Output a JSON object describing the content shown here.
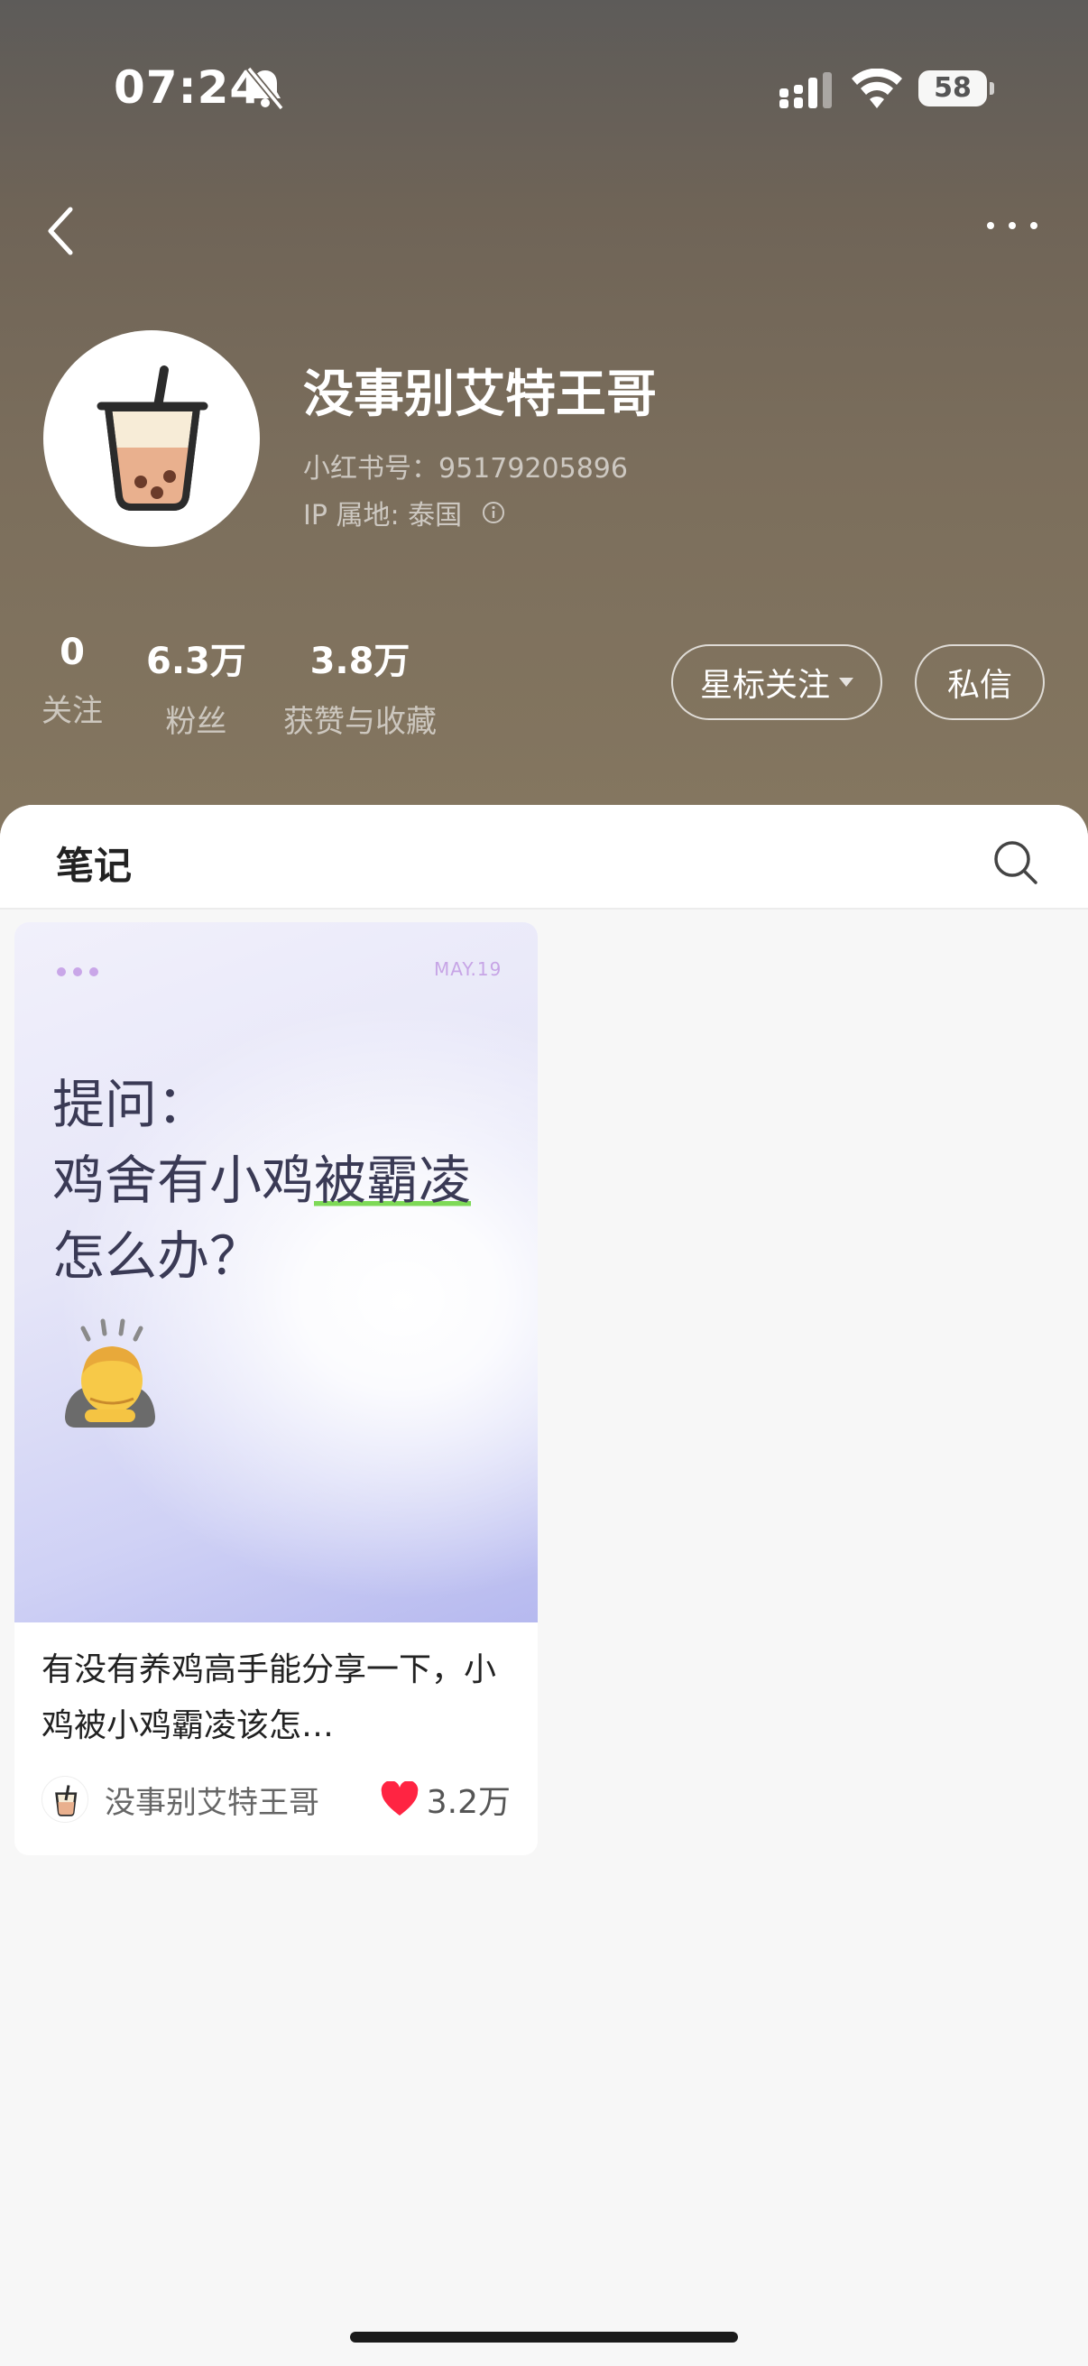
{
  "status_bar": {
    "time": "07:24",
    "battery": "58"
  },
  "profile": {
    "nickname": "没事别艾特王哥",
    "red_id": "小红书号：95179205896",
    "ip_location": "IP 属地: 泰国"
  },
  "stats": [
    {
      "value": "0",
      "label": "关注"
    },
    {
      "value": "6.3万",
      "label": "粉丝"
    },
    {
      "value": "3.8万",
      "label": "获赞与收藏"
    }
  ],
  "actions": {
    "star_follow": "星标关注",
    "message": "私信"
  },
  "tabs": {
    "notes": "笔记"
  },
  "note": {
    "cover_date": "MAY.19",
    "cover_line1": "提问：",
    "cover_line2_a": "鸡舍有小鸡",
    "cover_line2_b": "被霸凌",
    "cover_line3": "怎么办？",
    "title": "有没有养鸡高手能分享一下，小鸡被小鸡霸凌该怎…",
    "author": "没事别艾特王哥",
    "likes": "3.2万"
  },
  "colors": {
    "accent_like": "#ff2442",
    "highlight": "#7ed957"
  }
}
